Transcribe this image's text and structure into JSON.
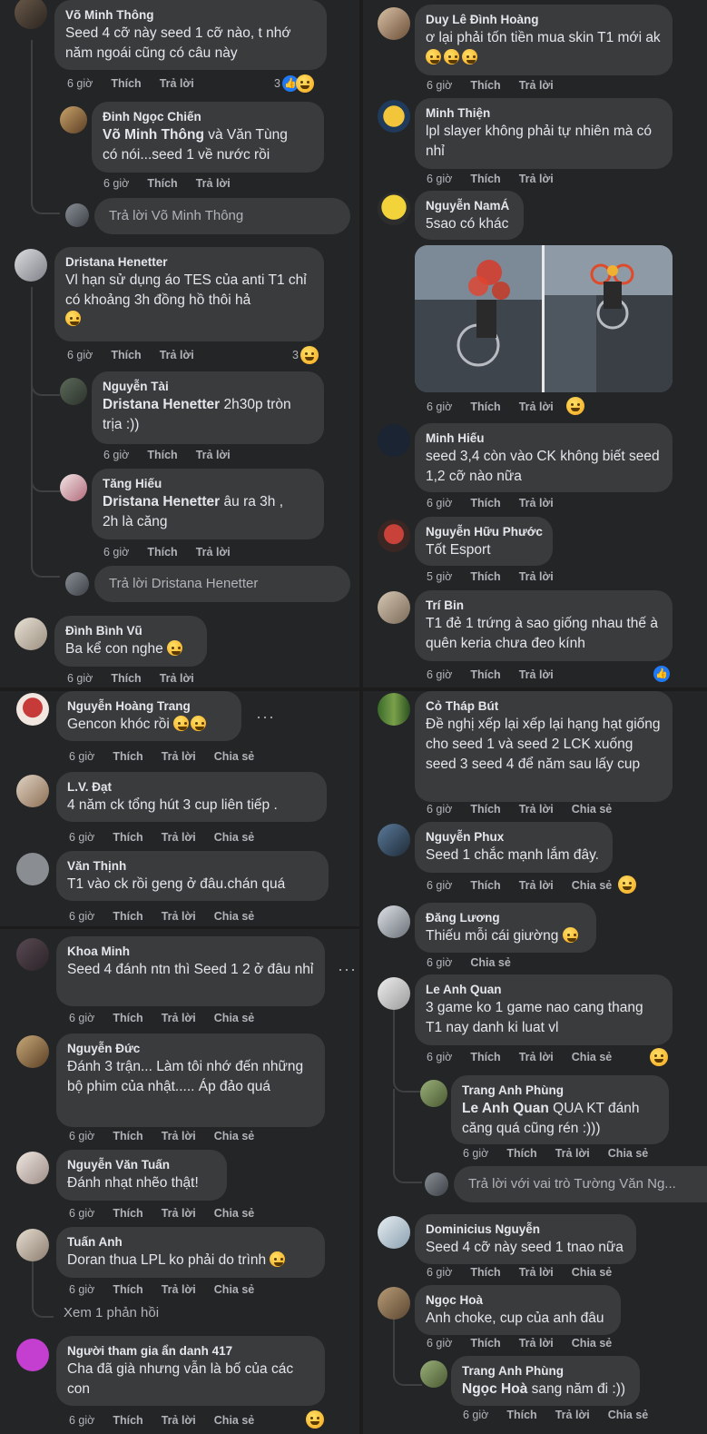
{
  "actions": {
    "time": "6 giờ",
    "time5": "5 giờ",
    "like": "Thích",
    "reply": "Trả lời",
    "share": "Chia sẻ"
  },
  "p1": {
    "c1": {
      "name": "Võ Minh Thông",
      "text": "Seed 4 cỡ này seed 1 cỡ nào, t nhớ năm ngoái cũng có câu này",
      "react_count": "3"
    },
    "c1r1": {
      "name": "Đinh Ngọc Chiến",
      "mention": "Võ Minh Thông",
      "text1": " và Văn Tùng",
      "text2": "có nói...seed 1 về nước rồi"
    },
    "c1box": "Trả lời Võ Minh Thông",
    "c2": {
      "name": "Dristana Henetter",
      "text": "Vl hạn sử dụng áo TES của anti T1 chỉ có khoảng 3h đồng hồ thôi hả",
      "react_count": "3"
    },
    "c2r1": {
      "name": "Nguyễn Tài",
      "mention": "Dristana Henetter",
      "text1": " 2h30p tròn",
      "text2": "trịa :))"
    },
    "c2r2": {
      "name": "Tăng Hiếu",
      "mention": "Dristana Henetter",
      "text1": " âu ra 3h ,",
      "text2": "2h là căng"
    },
    "c2box": "Trả lời Dristana Henetter",
    "c3": {
      "name": "Đình Bình Vũ",
      "text": "Ba kể con nghe"
    }
  },
  "p2": {
    "c1": {
      "name": "Duy Lê Đình Hoàng",
      "text": "ơ lại phải tốn tiền mua skin T1 mới ak"
    },
    "c2": {
      "name": "Minh Thiện",
      "text": "lpl slayer không phải tự nhiên mà có nhỉ"
    },
    "c3": {
      "name": "Nguyễn NamÁ",
      "text": "5sao có khác"
    },
    "c4": {
      "name": "Minh Hiếu",
      "text": "seed 3,4 còn vào CK không biết seed 1,2 cỡ nào nữa"
    },
    "c5": {
      "name": "Nguyễn Hữu Phước",
      "text": "Tốt Esport"
    },
    "c6": {
      "name": "Trí Bin",
      "text": "T1 đẻ 1 trứng à sao giống nhau thế à quên keria chưa đeo kính"
    }
  },
  "p3": {
    "c1": {
      "name": "Nguyễn Hoàng Trang",
      "text": "Gencon khóc rồi"
    },
    "c2": {
      "name": "L.V. Đạt",
      "text": "4 năm ck tổng hút 3 cup liên tiếp ."
    },
    "c3": {
      "name": "Văn Thịnh",
      "text": "T1 vào ck rồi geng ở đâu.chán quá"
    }
  },
  "p4": {
    "c1": {
      "name": "Khoa Minh",
      "text": "Seed 4 đánh ntn thì Seed 1 2 ở đâu nhỉ"
    },
    "c2": {
      "name": "Nguyễn Đức",
      "text": "Đánh 3 trận... Làm tôi nhớ đến những bộ phim của nhật..... Áp đảo quá"
    },
    "c3": {
      "name": "Nguyễn Văn Tuấn",
      "text": "Đánh nhạt nhẽo thật!"
    },
    "c4": {
      "name": "Tuấn Anh",
      "text": "Doran thua LPL ko phải do trình",
      "view_more": "Xem 1 phản hồi"
    },
    "c5": {
      "name": "Người tham gia ẩn danh 417",
      "text": "Cha đã già nhưng vẫn là bố của các con"
    }
  },
  "p5": {
    "c1": {
      "name": "Cỏ Tháp Bút",
      "text": "Đề nghị xếp lại xếp lại hạng hạt giống cho seed 1 và seed 2 LCK xuống seed 3 seed 4 để năm sau lấy cup"
    },
    "c2": {
      "name": "Nguyễn Phux",
      "text": "Seed 1 chắc mạnh lắm đây."
    },
    "c3": {
      "name": "Đăng Lương",
      "text": "Thiếu mỗi cái giường"
    },
    "c4": {
      "name": "Le Anh Quan",
      "text": "3 game ko 1 game nao cang thang T1 nay danh ki luat vl"
    },
    "c4r1": {
      "name": "Trang Anh Phùng",
      "mention": "Le Anh Quan",
      "text1": " QUA KT đánh",
      "text2": "căng quá cũng rén :)))"
    },
    "c4box": "Trả lời với vai trò Tường Văn Ng...",
    "c5": {
      "name": "Dominicius Nguyễn",
      "text": "Seed 4 cỡ này seed 1 tnao nữa"
    },
    "c6": {
      "name": "Ngọc Hoà",
      "text": "Anh choke, cup của anh đâu"
    },
    "c6r1": {
      "name": "Trang Anh Phùng",
      "mention": "Ngọc Hoà",
      "text1": " sang năm đi :))"
    }
  },
  "colors": {
    "panel": "#242526",
    "bubble": "#3a3b3c",
    "accent": "#2078f4",
    "muted": "#b0b3b8"
  },
  "icons": {
    "like": "thumbs-up-icon",
    "haha": "laughing-emoji-icon",
    "more": "more-dots-icon"
  }
}
